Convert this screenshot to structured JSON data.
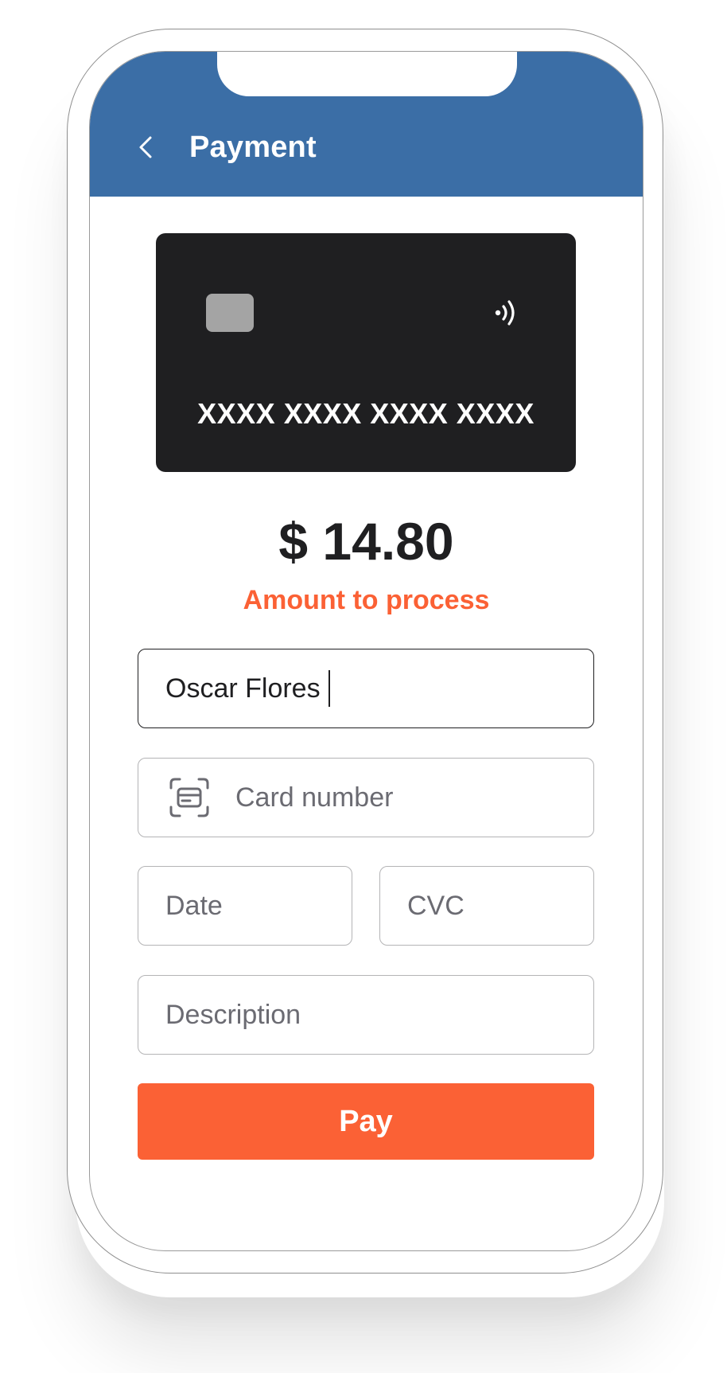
{
  "header": {
    "title": "Payment",
    "back_icon": "chevron-left-icon",
    "background": "#3b6ea6"
  },
  "card": {
    "number_mask": "XXXX XXXX XXXX XXXX",
    "chip_icon": "card-chip-icon",
    "contactless_icon": "contactless-icon",
    "background": "#1f1f21"
  },
  "payment": {
    "amount": "$ 14.80",
    "amount_label": "Amount to process",
    "accent_color": "#fb6135"
  },
  "form": {
    "name_value": "Oscar Flores",
    "card_number_placeholder": "Card number",
    "card_scan_icon": "card-scan-icon",
    "date_placeholder": "Date",
    "cvc_placeholder": "CVC",
    "description_placeholder": "Description"
  },
  "actions": {
    "pay_label": "Pay"
  }
}
